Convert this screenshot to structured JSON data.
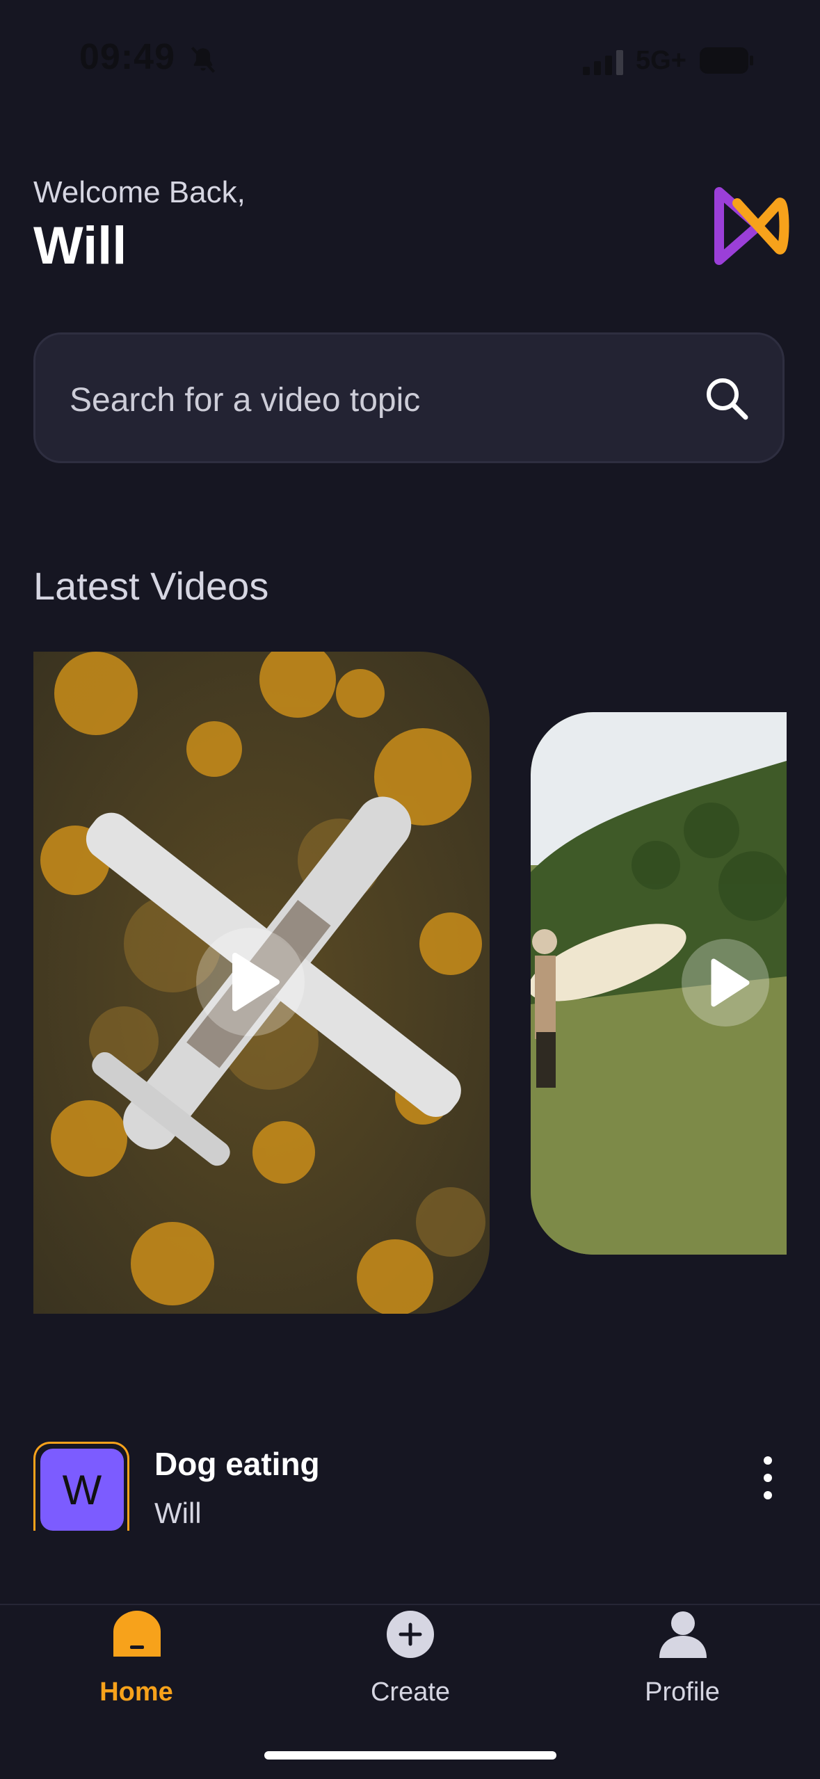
{
  "status_bar": {
    "time": "09:49",
    "network": "5G+"
  },
  "header": {
    "welcome": "Welcome Back,",
    "username": "Will"
  },
  "search": {
    "placeholder": "Search for a video topic"
  },
  "latest": {
    "title": "Latest Videos",
    "videos": [
      {
        "subject": "aerial-plane-wreck-forest"
      },
      {
        "subject": "surfer-walking-hillside"
      }
    ]
  },
  "list": {
    "items": [
      {
        "avatar_letter": "W",
        "title": "Dog eating",
        "author": "Will"
      }
    ]
  },
  "nav": {
    "home": "Home",
    "create": "Create",
    "profile": "Profile",
    "active": "home"
  },
  "colors": {
    "accent": "#f7a21b",
    "background": "#161622",
    "avatar": "#7c5cff",
    "logo_purple": "#9b3fd8"
  }
}
